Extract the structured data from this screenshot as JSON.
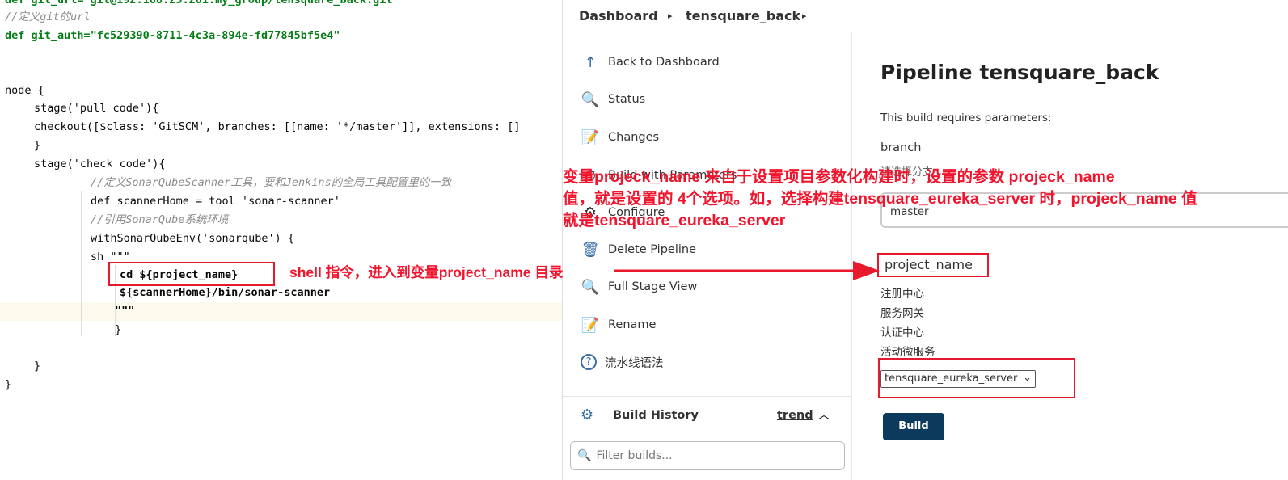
{
  "editor": {
    "lines": [
      {
        "t": "def git_url= git@192.168.25.201:my_group/tensquare_back.git"
      },
      {
        "t": "//定义git的url"
      },
      {
        "t": "def git_auth=\"fc529390-8711-4c3a-894e-fd77845bf5e4\""
      },
      {
        "t": "node {"
      },
      {
        "t": "stage('pull code'){"
      },
      {
        "t": "checkout([$class: 'GitSCM', branches: [[name: '*/master']], extensions: []"
      },
      {
        "t": "}"
      },
      {
        "t": "stage('check code'){"
      },
      {
        "t": "//定义SonarQubeScanner工具，要和Jenkins的全局工具配置里的一致"
      },
      {
        "t": "def scannerHome = tool 'sonar-scanner'"
      },
      {
        "t": "//引用SonarQube系统环境"
      },
      {
        "t": "withSonarQubeEnv('sonarqube') {"
      },
      {
        "t": "sh \"\"\""
      },
      {
        "t": "cd ${project_name}"
      },
      {
        "t": "${scannerHome}/bin/sonar-scanner"
      },
      {
        "t": "\"\"\""
      },
      {
        "t": "}"
      },
      {
        "t": "}"
      },
      {
        "t": "}"
      }
    ]
  },
  "header": {
    "breadcrumb": [
      "Dashboard",
      "tensquare_back"
    ]
  },
  "sidebar": {
    "items": [
      {
        "label": "Back to Dashboard",
        "icon": "arrow-up-icon"
      },
      {
        "label": "Status",
        "icon": "magnifier-icon"
      },
      {
        "label": "Changes",
        "icon": "notepad-icon"
      },
      {
        "label": "Build with Parameters",
        "icon": "clock-icon"
      },
      {
        "label": "Configure",
        "icon": "gear-icon"
      },
      {
        "label": "Delete Pipeline",
        "icon": "trash-icon"
      },
      {
        "label": "Full Stage View",
        "icon": "magnifier-icon"
      },
      {
        "label": "Rename",
        "icon": "notepad-icon"
      },
      {
        "label": "流水线语法",
        "icon": "question-icon"
      }
    ],
    "build_history": {
      "title": "Build History",
      "trend": "trend",
      "filter_placeholder": "Filter builds..."
    }
  },
  "main": {
    "title": "Pipeline tensquare_back",
    "requires": "This build requires parameters:",
    "param1": {
      "name": "branch",
      "desc": "请选择分支",
      "value": "master"
    },
    "param2": {
      "name": "project_name",
      "options": [
        "注册中心",
        "服务网关",
        "认证中心",
        "活动微服务"
      ],
      "selected": "tensquare_eureka_server"
    },
    "build": "Build"
  },
  "annotations": {
    "top": [
      "变量projeck_name 来自于设置项目参数化构建时，设置的参数 projeck_name",
      "值，就是设置的 4个选项。如，选择构建tensquare_eureka_server 时，projeck_name 值",
      "就是tensquare_eureka_server"
    ],
    "shell": "shell 指令，进入到变量project_name 目录"
  },
  "colors": {
    "annotation": "#f0142d",
    "build_button": "#0b3a5c"
  }
}
